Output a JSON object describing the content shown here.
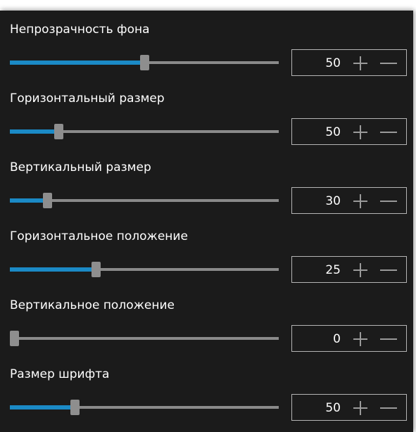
{
  "settings": [
    {
      "label": "Непрозрачность фона",
      "value": "50",
      "slider_fraction": 0.5
    },
    {
      "label": "Горизонтальный размер",
      "value": "50",
      "slider_fraction": 0.18
    },
    {
      "label": "Вертикальный размер",
      "value": "30",
      "slider_fraction": 0.14
    },
    {
      "label": "Горизонтальное положение",
      "value": "25",
      "slider_fraction": 0.32
    },
    {
      "label": "Вертикальное положение",
      "value": "0",
      "slider_fraction": 0.0
    },
    {
      "label": "Размер шрифта",
      "value": "50",
      "slider_fraction": 0.24
    }
  ],
  "icons": {
    "increment": "plus-icon",
    "decrement": "minus-icon"
  },
  "colors": {
    "background": "#1b1b1b",
    "accent": "#1b8ac6",
    "track": "#8a8a8a",
    "text": "#ffffff",
    "box_border": "#b5b5b5"
  }
}
